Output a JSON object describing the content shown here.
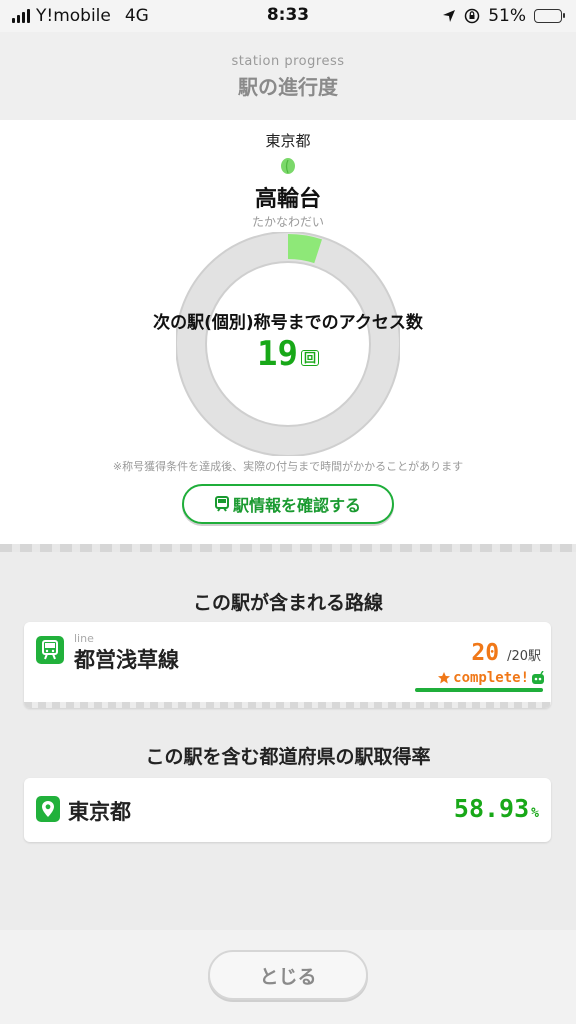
{
  "status_bar": {
    "carrier": "Y!mobile",
    "network": "4G",
    "time": "8:33",
    "battery": "51%",
    "battery_level": 0.51
  },
  "header": {
    "subtitle": "station progress",
    "title": "駅の進行度"
  },
  "station": {
    "prefecture": "東京都",
    "name": "高輪台",
    "reading": "たかなわだい",
    "progress_label": "次の駅(個別)称号までのアクセス数",
    "access_count": "19",
    "count_unit": "回",
    "progress_fraction": 0.05,
    "note": "※称号獲得条件を達成後、実際の付与まで時間がかかることがあります",
    "info_button": "駅情報を確認する"
  },
  "colors": {
    "accent_green": "#1fae3a",
    "orange": "#f07818",
    "ring_gray": "#dedede",
    "ring_fill": "#8ee878"
  },
  "lines_section": {
    "title": "この駅が含まれる路線",
    "line": {
      "tag": "line",
      "name": "都営浅草線",
      "acquired": "20",
      "total": "/20駅",
      "complete_label": "complete!",
      "icon": "train-icon"
    }
  },
  "prefecture_section": {
    "title": "この駅を含む都道府県の駅取得率",
    "name": "東京都",
    "rate": "58.93",
    "rate_unit": "%",
    "icon": "map-pin-icon"
  },
  "close_button": "とじる"
}
